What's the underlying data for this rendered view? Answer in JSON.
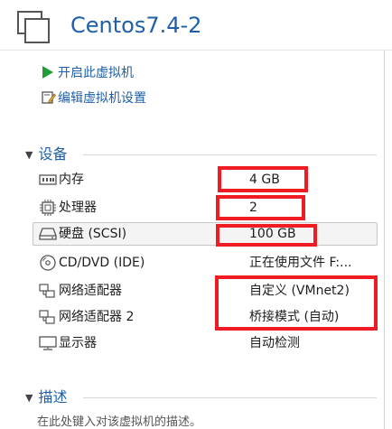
{
  "vm": {
    "name": "Centos7.4-2",
    "name_icon": "vm-window-icon"
  },
  "actions": [
    {
      "label": "开启此虚拟机",
      "icon": "play-icon"
    },
    {
      "label": "编辑虚拟机设置",
      "icon": "edit-settings-icon"
    }
  ],
  "devices_section": {
    "title": "设备",
    "items": [
      {
        "name": "内存",
        "value": "4 GB",
        "icon": "memory-icon"
      },
      {
        "name": "处理器",
        "value": "2",
        "icon": "cpu-icon"
      },
      {
        "name": "硬盘 (SCSI)",
        "value": "100 GB",
        "icon": "hard-disk-icon"
      },
      {
        "name": "CD/DVD (IDE)",
        "value": "正在使用文件 F:...",
        "icon": "cd-dvd-icon"
      },
      {
        "name": "网络适配器",
        "value": "自定义 (VMnet2)",
        "icon": "network-adapter-icon"
      },
      {
        "name": "网络适配器 2",
        "value": "桥接模式 (自动)",
        "icon": "network-adapter-icon"
      },
      {
        "name": "显示器",
        "value": "自动检测",
        "icon": "display-icon"
      }
    ]
  },
  "description_section": {
    "title": "描述",
    "placeholder": "在此处键入对该虚拟机的描述。"
  },
  "colors": {
    "accent_blue": "#1f5fa8",
    "play_green": "#1e9e3a",
    "highlight_red": "#ef1c24"
  }
}
